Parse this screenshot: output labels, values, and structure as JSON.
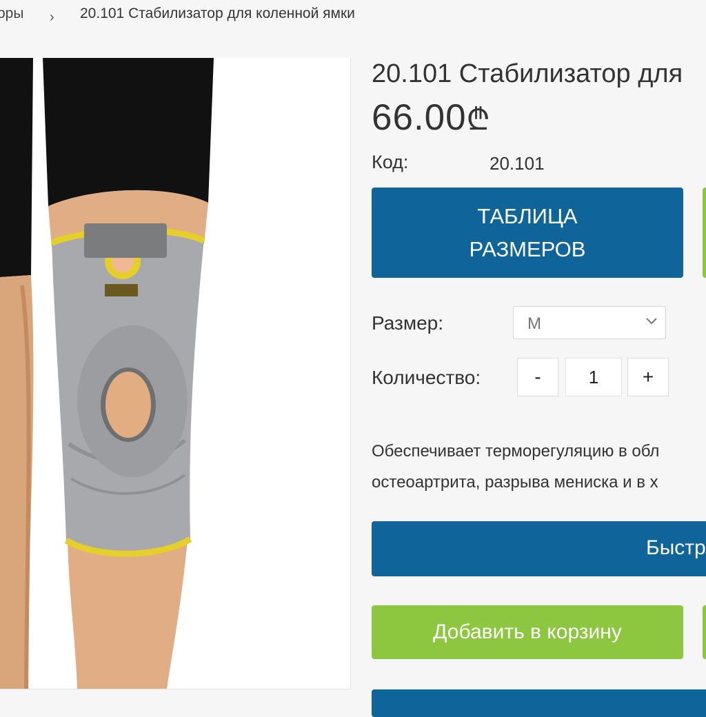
{
  "breadcrumb": {
    "previous": "оры",
    "separator": "›",
    "current": "20.101 Стабилизатор для коленной ямки"
  },
  "product": {
    "image_alt": "knee-stabilizer-photo",
    "title": "20.101 Стабилизатор для",
    "price_amount": "66.00",
    "price_currency": "₾",
    "code_label": "Код:",
    "code_value": "20.101",
    "size_table_button": "ТАБЛИЦА РАЗМЕРОВ",
    "size_label": "Размер:",
    "size_selected": "M",
    "quantity_label": "Количество:",
    "quantity_minus": "-",
    "quantity_value": "1",
    "quantity_plus": "+",
    "description_line1": "Обеспечивает терморегуляцию в обл",
    "description_line2": "остеоартрита, разрыва мениска и в х",
    "quick_order_button": "Быстр",
    "add_to_cart_button": "Добавить в корзину"
  },
  "colors": {
    "primary_blue": "#0f6599",
    "accent_green": "#8dc63f",
    "brace_gray": "#a7a9ac",
    "brace_yellow": "#e6cf2a"
  }
}
